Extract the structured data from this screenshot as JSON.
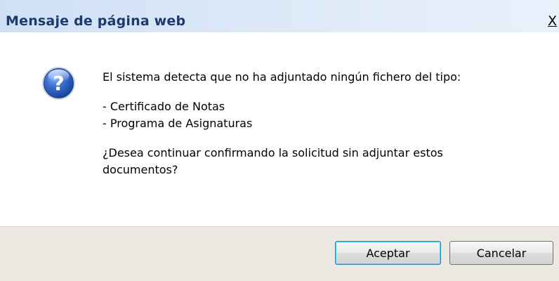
{
  "dialog": {
    "title": "Mensaje de página web",
    "close_label": "X",
    "icon": "question-icon",
    "message": {
      "line1": "El sistema detecta que no ha adjuntado ningún fichero del tipo:",
      "item1": "- Certificado de Notas",
      "item2": "- Programa de Asignaturas",
      "line2": "¿Desea continuar confirmando la solicitud sin adjuntar estos",
      "line3": "documentos?"
    },
    "buttons": {
      "accept": "Aceptar",
      "cancel": "Cancelar"
    },
    "colors": {
      "title_text": "#1c3a6b",
      "footer_bg": "#ece9e3",
      "icon_blue": "#2a5bb8"
    }
  }
}
